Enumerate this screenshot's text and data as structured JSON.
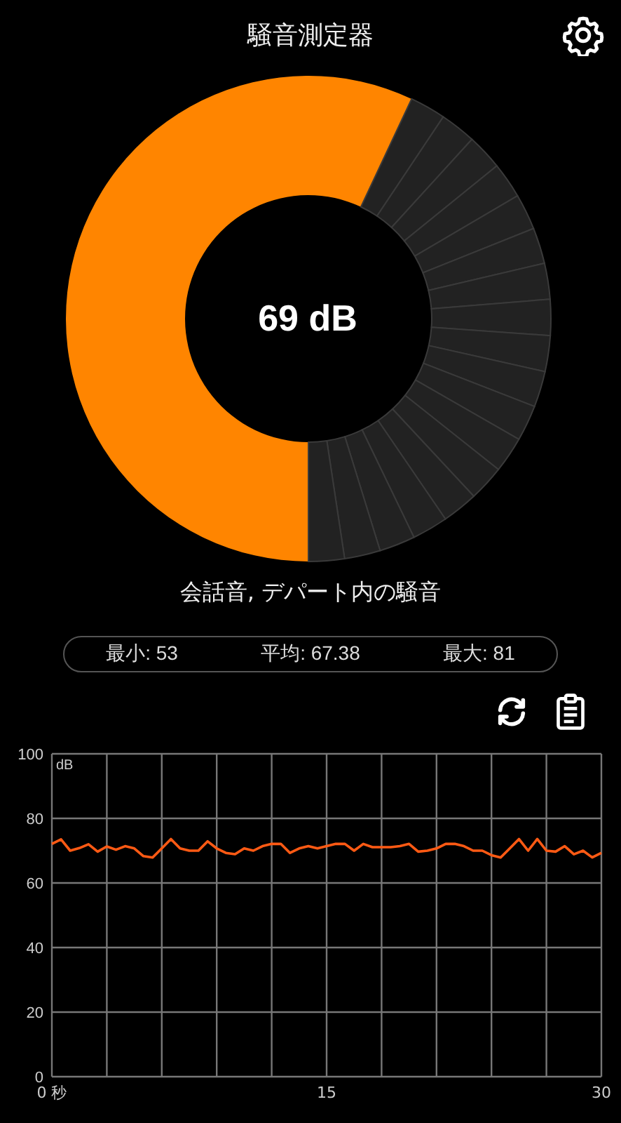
{
  "header": {
    "title": "騒音測定器"
  },
  "gauge": {
    "reading": "69 dB"
  },
  "description": "会話音, デパート内の騒音",
  "stats": [
    {
      "label": "最小: 53"
    },
    {
      "label": "平均: 67.38"
    },
    {
      "label": "最大: 81"
    }
  ],
  "history": {
    "chart_data": {
      "type": "line",
      "ylabel": "dB",
      "grid": true,
      "xlim": [
        0,
        30
      ],
      "ylim": [
        0,
        100
      ],
      "yticks": [
        0,
        20,
        40,
        60,
        80,
        100
      ],
      "xticks": [
        {
          "value": 0,
          "label": "0 秒"
        },
        15,
        30
      ],
      "x": [
        0,
        0.5,
        1,
        1.5,
        2,
        2.5,
        3,
        3.5,
        4,
        4.5,
        5,
        5.5,
        6,
        6.5,
        7,
        7.5,
        8,
        8.5,
        9,
        9.5,
        10,
        10.5,
        11,
        11.5,
        12,
        12.5,
        13,
        13.5,
        14,
        14.5,
        15,
        15.5,
        16,
        16.5,
        17,
        17.5,
        18,
        18.5,
        19,
        19.5,
        20,
        20.5,
        21,
        21.5,
        22,
        22.5,
        23,
        23.5,
        24,
        24.5,
        25,
        25.5,
        26,
        26.5,
        27,
        27.5,
        28,
        28.5,
        29,
        29.5,
        30
      ],
      "series": [
        {
          "color": "#ff5a14",
          "values": [
            72.1,
            73.5,
            70,
            70.8,
            72,
            69.7,
            71.3,
            70.3,
            71.4,
            70.7,
            68.3,
            67.9,
            70.7,
            73.6,
            70.7,
            70,
            70,
            72.9,
            70.7,
            69.3,
            68.9,
            70.7,
            70,
            71.4,
            72.1,
            72.1,
            69.3,
            70.7,
            71.4,
            70.7,
            71.4,
            72.1,
            72.1,
            70,
            72.1,
            71.1,
            71.1,
            71.1,
            71.4,
            72.1,
            69.7,
            70,
            70.7,
            72.1,
            72.1,
            71.4,
            70,
            70,
            68.6,
            67.9,
            70.7,
            73.6,
            70,
            73.6,
            70,
            69.7,
            71.4,
            68.9,
            70,
            67.9,
            69.3
          ]
        }
      ]
    }
  }
}
